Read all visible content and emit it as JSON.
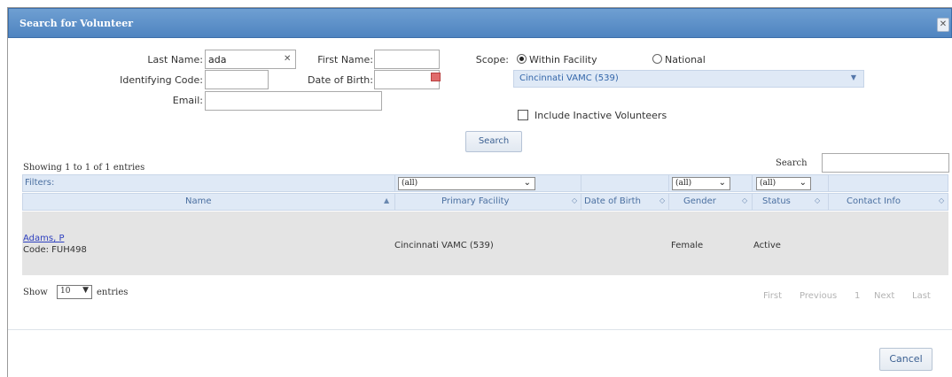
{
  "dialog": {
    "title": "Search for Volunteer",
    "close_icon": "close-icon"
  },
  "form": {
    "last_name_label": "Last Name:",
    "last_name_value": "ada",
    "first_name_label": "First Name:",
    "first_name_value": "",
    "identifying_code_label": "Identifying Code:",
    "identifying_code_value": "",
    "dob_label": "Date of Birth:",
    "dob_value": "",
    "email_label": "Email:",
    "email_value": "",
    "scope_label": "Scope:",
    "scope_within": "Within Facility",
    "scope_national": "National",
    "scope_selected": "Within Facility",
    "facility": "Cincinnati VAMC (539)",
    "include_inactive_label": "Include Inactive Volunteers",
    "include_inactive_checked": false,
    "search_button": "Search"
  },
  "table": {
    "info": "Showing 1 to 1 of 1 entries",
    "search_label": "Search",
    "search_value": "",
    "filters_label": "Filters:",
    "filter_facility": "(all)",
    "filter_gender": "(all)",
    "filter_status": "(all)",
    "columns": [
      "Name",
      "Primary Facility",
      "Date of Birth",
      "Gender",
      "Status",
      "Contact Info"
    ],
    "rows": [
      {
        "name": "Adams, P",
        "code": "Code: FUH498",
        "facility": "Cincinnati VAMC (539)",
        "dob": "",
        "gender": "Female",
        "status": "Active",
        "contact": ""
      }
    ],
    "show_label": "Show",
    "show_value": "10",
    "entries_label": "entries",
    "pager": [
      "First",
      "Previous",
      "1",
      "Next",
      "Last"
    ]
  },
  "footer": {
    "cancel_button": "Cancel"
  }
}
